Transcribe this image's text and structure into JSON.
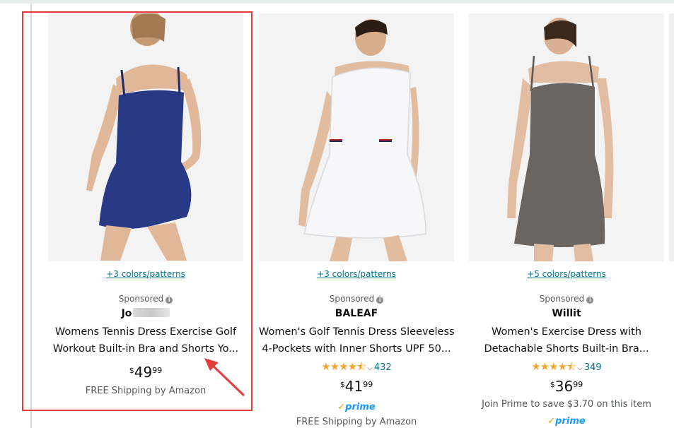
{
  "products": [
    {
      "colors_link": "+3 colors/patterns",
      "sponsored_label": "Sponsored",
      "brand": "Jo",
      "title_line1": "Womens Tennis Dress Exercise Golf",
      "title_line2": "Workout Built-in Bra and Shorts Yo...",
      "price_symbol": "$",
      "price_whole": "49",
      "price_fraction": "99",
      "shipping": "FREE Shipping by Amazon",
      "dress_color": "#283a85",
      "highlighted": true
    },
    {
      "colors_link": "+3 colors/patterns",
      "sponsored_label": "Sponsored",
      "brand": "BALEAF",
      "title_line1": "Women's Golf Tennis Dress Sleeveless",
      "title_line2": "4-Pockets with Inner Shorts UPF 50...",
      "rating_stars": 4.5,
      "rating_count": "432",
      "price_symbol": "$",
      "price_whole": "41",
      "price_fraction": "99",
      "prime_label": "prime",
      "shipping": "FREE Shipping by Amazon",
      "dress_color": "#f4f4f6"
    },
    {
      "colors_link": "+5 colors/patterns",
      "sponsored_label": "Sponsored",
      "brand": "Willit",
      "title_line1": "Women's Exercise Dress with",
      "title_line2": "Detachable Shorts Built-in Bra...",
      "rating_stars": 4.5,
      "rating_count": "349",
      "price_symbol": "$",
      "price_whole": "36",
      "price_fraction": "99",
      "prime_offer": "Join Prime to save $3.70 on this item",
      "prime_label": "prime",
      "dress_color": "#6b6561"
    }
  ],
  "colors": {
    "link": "#007185",
    "star": "#f0a630",
    "prime_blue": "#1a98ff",
    "annotation_red": "#e53b3b"
  }
}
